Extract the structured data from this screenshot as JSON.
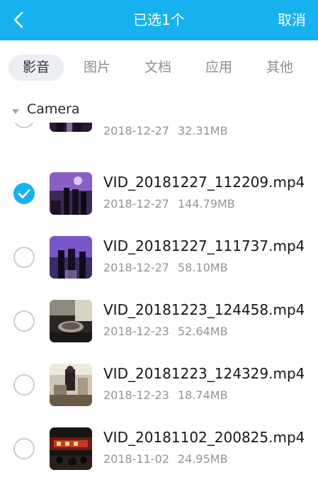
{
  "header": {
    "back_icon": "chevron-left-icon",
    "title": "已选1个",
    "cancel_label": "取消",
    "background_color": "#16b2ef"
  },
  "tabs": [
    {
      "label": "影音",
      "active": true
    },
    {
      "label": "图片",
      "active": false
    },
    {
      "label": "文档",
      "active": false
    },
    {
      "label": "应用",
      "active": false
    },
    {
      "label": "其他",
      "active": false
    }
  ],
  "section": {
    "label": "Camera",
    "expand_icon": "triangle-down-icon"
  },
  "files": [
    {
      "name": "",
      "date": "2018-12-27",
      "size": "32.31MB",
      "selected": false
    },
    {
      "name": "VID_20181227_112209.mp4",
      "date": "2018-12-27",
      "size": "144.79MB",
      "selected": true
    },
    {
      "name": "VID_20181227_111737.mp4",
      "date": "2018-12-27",
      "size": "58.10MB",
      "selected": false
    },
    {
      "name": "VID_20181223_124458.mp4",
      "date": "2018-12-23",
      "size": "52.64MB",
      "selected": false
    },
    {
      "name": "VID_20181223_124329.mp4",
      "date": "2018-12-23",
      "size": "18.74MB",
      "selected": false
    },
    {
      "name": "VID_20181102_200825.mp4",
      "date": "2018-11-02",
      "size": "24.95MB",
      "selected": false
    }
  ]
}
